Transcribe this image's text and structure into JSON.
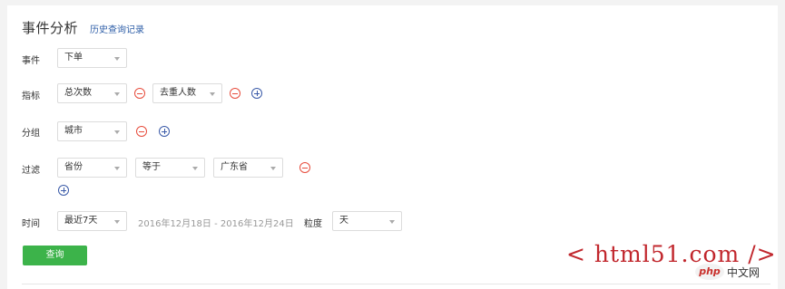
{
  "header": {
    "title": "事件分析",
    "history_link": "历史查询记录"
  },
  "event": {
    "label": "事件",
    "select_value": "下单"
  },
  "metric": {
    "label": "指标",
    "select1_value": "总次数",
    "select2_value": "去重人数"
  },
  "group": {
    "label": "分组",
    "select_value": "城市"
  },
  "filter": {
    "label": "过滤",
    "field_value": "省份",
    "operator_value": "等于",
    "value_value": "广东省"
  },
  "time": {
    "label": "时间",
    "range_value": "最近7天",
    "date_range": "2016年12月18日 - 2016年12月24日",
    "granularity_label": "粒度",
    "granularity_value": "天"
  },
  "query_button": "查询",
  "watermark": {
    "text": "< html51.com />",
    "php_badge": "php",
    "php_cn": "中文网"
  },
  "colors": {
    "query_green": "#3cb34a",
    "remove_red": "#e74c3c",
    "add_blue": "#3a5aa8",
    "link_blue": "#2f5fa8",
    "watermark_red": "#c1272d"
  },
  "icons": {
    "remove": "minus-circle-icon",
    "add": "plus-circle-icon",
    "dropdown": "caret-down-icon"
  }
}
